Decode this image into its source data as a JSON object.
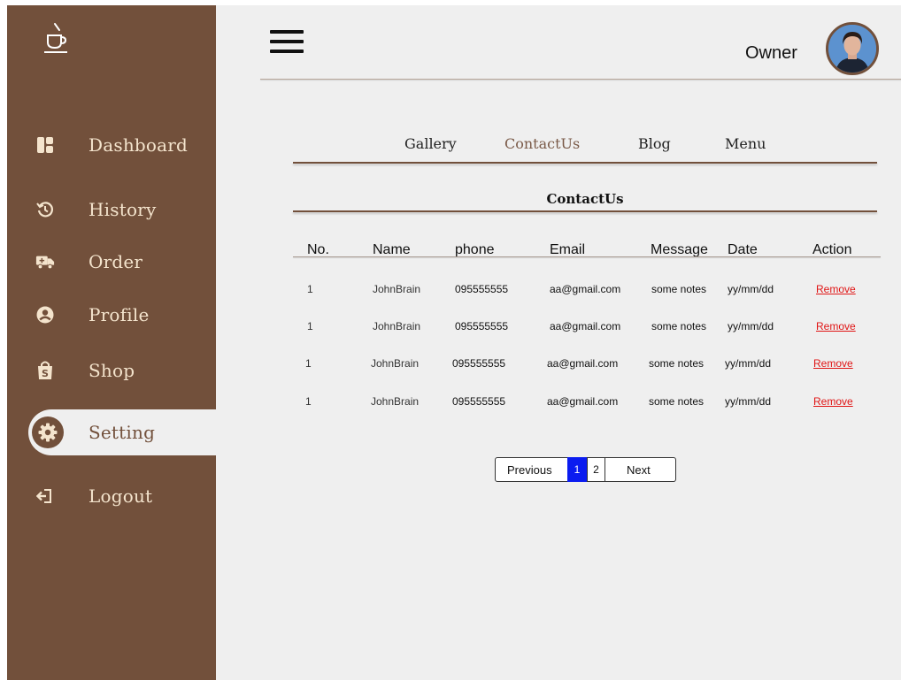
{
  "sidebar": {
    "items": [
      {
        "label": "Dashboard",
        "icon": "dashboard-icon"
      },
      {
        "label": "History",
        "icon": "history-icon"
      },
      {
        "label": "Order",
        "icon": "truck-icon"
      },
      {
        "label": "Profile",
        "icon": "user-icon"
      },
      {
        "label": "Shop",
        "icon": "shopping-bag-icon"
      },
      {
        "label": "Setting",
        "icon": "gear-icon",
        "active": true
      },
      {
        "label": "Logout",
        "icon": "logout-icon"
      }
    ]
  },
  "header": {
    "user_name": "Owner"
  },
  "tabs": [
    "Gallery",
    "ContactUs",
    "Blog",
    "Menu"
  ],
  "active_tab": "ContactUs",
  "section_title": "ContactUs",
  "table": {
    "headers": [
      "No.",
      "Name",
      "phone",
      "Email",
      "Message",
      "Date",
      "Action"
    ],
    "rows": [
      {
        "no": "1",
        "name": "JohnBrain",
        "phone": "095555555",
        "email": "aa@gmail.com",
        "message": "some notes",
        "date": "yy/mm/dd",
        "action": "Remove"
      },
      {
        "no": "1",
        "name": "JohnBrain",
        "phone": "095555555",
        "email": "aa@gmail.com",
        "message": "some notes",
        "date": "yy/mm/dd",
        "action": "Remove"
      },
      {
        "no": "1",
        "name": "JohnBrain",
        "phone": "095555555",
        "email": "aa@gmail.com",
        "message": "some notes",
        "date": "yy/mm/dd",
        "action": "Remove"
      },
      {
        "no": "1",
        "name": "JohnBrain",
        "phone": "095555555",
        "email": "aa@gmail.com",
        "message": "some notes",
        "date": "yy/mm/dd",
        "action": "Remove"
      }
    ]
  },
  "pagination": {
    "previous": "Previous",
    "pages": [
      "1",
      "2"
    ],
    "current": "1",
    "next": "Next"
  },
  "colors": {
    "sidebar": "#72503b",
    "sidebar_text": "#f4e4cd",
    "background": "#efefef",
    "active_tab": "#7a5a48",
    "remove": "#e01515",
    "page_active": "#0b1cf0"
  }
}
